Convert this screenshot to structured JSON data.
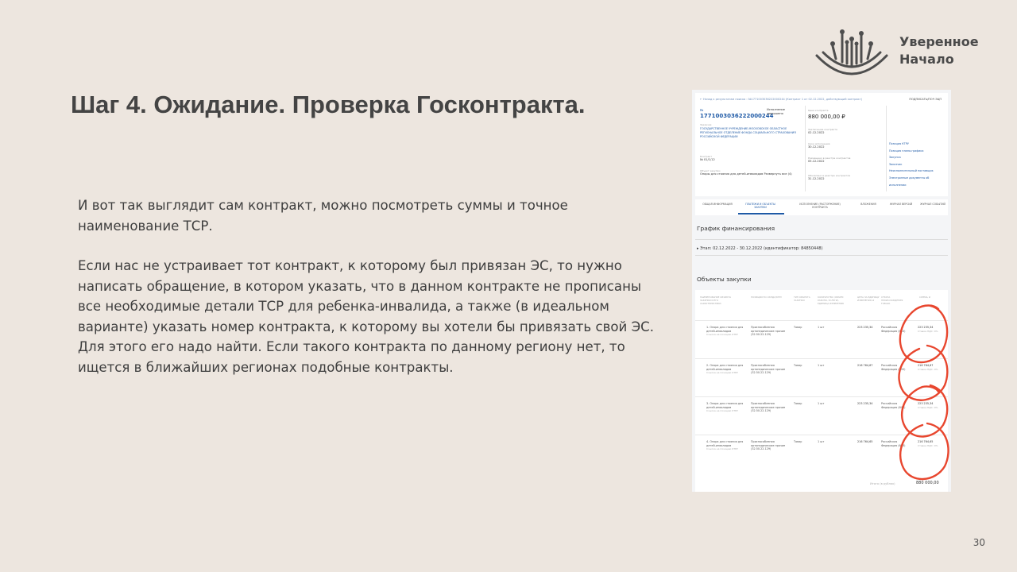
{
  "logo": {
    "line1": "Уверенное",
    "line2": "Начало"
  },
  "slide": {
    "title": "Шаг 4. Ожидание. Проверка Госконтракта.",
    "paragraph1": "И вот так выглядит сам контракт, можно посмотреть суммы и точное наименование ТСР.",
    "paragraph2": "Если нас не устраивает тот контракт, к которому был привязан ЭС, то нужно написать обращение, в котором указать, что в данном контракте не прописаны все необходимые детали ТСР для ребенка-инвалида, а также (в идеальном варианте) указать номер контракта, к которому вы хотели бы привязать свой ЭС. Для этого его надо найти. Если такого контракта по данному региону нет, то ищется в ближайших регионах подобные контракты.",
    "page_number": "30"
  },
  "screenshot": {
    "breadcrumb": "← Назад к результатам поиска › №1771003036222000244 (Контракт 1 от 02.12.2022, действующий контракт)",
    "sign_button": "ПОДПИСАТЬ/ПОЧ ЭЦП",
    "reg_label": "№",
    "reg_number": "1771003036222000244",
    "status": "Исполнение завершено",
    "org_label": "Заказчик",
    "org": "ГОСУДАРСТВЕННОЕ УЧРЕЖДЕНИЕ-МОСКОВСКОЕ ОБЛАСТНОЕ РЕГИОНАЛЬНОЕ ОТДЕЛЕНИЕ ФОНДА СОЦИАЛЬНОГО СТРАХОВАНИЯ РОССИЙСКОЙ ФЕДЕРАЦИИ",
    "contract_label": "Контракт",
    "contract_value": "№ 01/1/12",
    "object_label": "Объект закупки",
    "object_value": "Опоры для стояния для детей-инвалидов  Развернуть все (4)",
    "price_label": "Цена контракта",
    "price": "880 000,00 ₽",
    "dates": [
      {
        "label": "Заключение контракта",
        "value": "02.12.2022"
      },
      {
        "label": "Срок исполнения",
        "value": "30.12.2022"
      },
      {
        "label": "Размещено в реестре контрактов",
        "value": "05.12.2022"
      },
      {
        "label": "Обновлено в реестре контрактов",
        "value": "31.12.2022"
      }
    ],
    "links": [
      "Позиция КТРУ",
      "Позиция плана-графика",
      "Закупка",
      "Заказчик",
      "Неисполнительный поставщик",
      "Электронные документы об исполнении"
    ],
    "tabs": [
      "ОБЩАЯ ИНФОРМАЦИЯ",
      "ПЛАТЕЖИ И ОБЪЕКТЫ ЗАКУПКИ",
      "ИСПОЛНЕНИЕ (РАСТОРЖЕНИЕ) КОНТРАКТА",
      "ВЛОЖЕНИЯ",
      "ЖУРНАЛ ВЕРСИЙ",
      "ЖУРНАЛ СОБЫТИЙ"
    ],
    "finance_title": "График финансирования",
    "stage": "▸ Этап: 02.12.2022 - 30.12.2022 (идентификатор: 84850448)",
    "objects_title": "Объекты закупки",
    "table_headers": [
      "НАИМЕНОВАНИЕ ОБЪЕКТА ЗАКУПКИ И ЕГО ХАРАКТЕРИСТИКИ",
      "ПОЗИЦИИ ПО ОКПД2/КТРУ",
      "ТИП ОБЪЕКТА ЗАКУПКИ",
      "КОЛИЧЕСТВО (ОБЪЕМ РАБОТЫ, УСЛУГИ), ЕДИНИЦА ИЗМЕРЕНИЯ",
      "ЦЕНА ЗА ЕДИНИЦУ ИЗМЕРЕНИЯ, ₽",
      "СТРАНА ПРОИСХОЖДЕНИЯ ТОВАРА",
      "СУММА, ₽"
    ],
    "rows": [
      {
        "name": "1. Опора для стояния для детей-инвалидов",
        "okpd": "Приспособления ортопедические прочие (32.50.22.129)",
        "type": "Товар",
        "qty": "1 шт",
        "unit_price": "223 235,34",
        "country": "Российская Федерация (643)",
        "sum": "223 235,34"
      },
      {
        "name": "2. Опора для стояния для детей-инвалидов",
        "okpd": "Приспособления ортопедические прочие (32.50.22.129)",
        "type": "Товар",
        "qty": "1 шт",
        "unit_price": "216 764,67",
        "country": "Российская Федерация (643)",
        "sum": "216 764,67"
      },
      {
        "name": "3. Опора для стояния для детей-инвалидов",
        "okpd": "Приспособления ортопедические прочие (32.50.22.129)",
        "type": "Товар",
        "qty": "1 шт",
        "unit_price": "223 235,34",
        "country": "Российская Федерация (643)",
        "sum": "223 235,34"
      },
      {
        "name": "4. Опора для стояния для детей-инвалидов",
        "okpd": "Приспособления ортопедические прочие (32.50.22.129)",
        "type": "Товар",
        "qty": "1 шт",
        "unit_price": "216 764,65",
        "country": "Российская Федерация (643)",
        "sum": "216 764,65"
      }
    ],
    "row_sub": "Ставка НДС: 0%",
    "row_name_sub": "Ссылка на позицию КТРУ",
    "total_label": "Итого (в рублях)",
    "total_value": "880 000,00"
  }
}
